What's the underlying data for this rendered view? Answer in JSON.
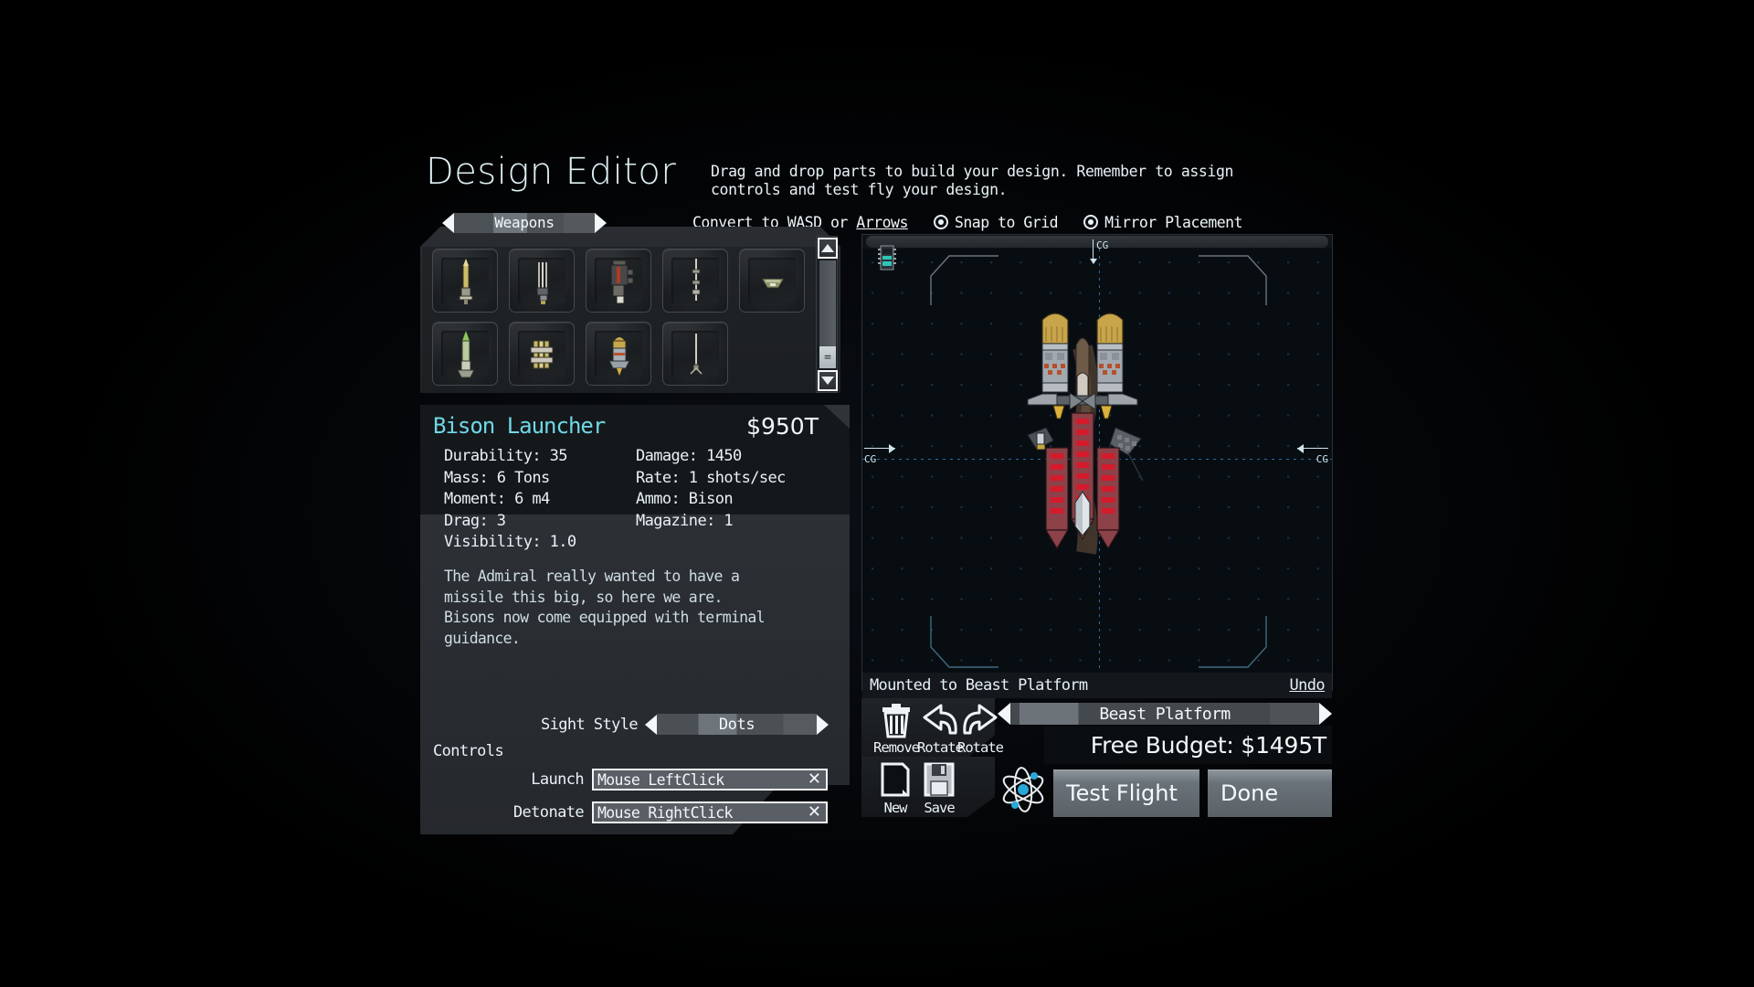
{
  "header": {
    "title": "Design Editor",
    "subtitle": "Drag and drop parts to build your design. Remember to assign controls and test fly your design."
  },
  "toolbar": {
    "convert_prefix": "Convert to ",
    "convert_wasd": "WASD",
    "convert_or": " or ",
    "convert_arrows": "Arrows",
    "snap_to_grid": "Snap to Grid",
    "snap_to_grid_on": true,
    "mirror_placement": "Mirror Placement",
    "mirror_placement_on": true
  },
  "palette": {
    "category": "Weapons",
    "prev_label": "previous category",
    "next_label": "next category",
    "slots_row1": [
      "missile-gold-icon",
      "multi-barrel-icon",
      "turret-red-icon",
      "beam-rod-icon",
      "dish-pod-icon"
    ],
    "slots_row2": [
      "missile-green-icon",
      "bundle-tubes-icon",
      "bison-launcher-icon",
      "thin-spike-icon"
    ],
    "scrollbar": {
      "grip": "="
    }
  },
  "part": {
    "name": "Bison Launcher",
    "price": "$950T",
    "stats_left": [
      "Durability: 35",
      "Mass: 6 Tons",
      "Moment: 6 m4",
      "Drag: 3",
      "Visibility: 1.0"
    ],
    "stats_right": [
      "Damage: 1450",
      "Rate: 1 shots/sec",
      "Ammo: Bison",
      "Magazine: 1"
    ],
    "description": "The Admiral really wanted to have a\nmissile this big, so here we are.\nBisons now come equipped with terminal\nguidance."
  },
  "sight": {
    "label": "Sight Style",
    "value": "Dots"
  },
  "controls": {
    "title": "Controls",
    "bindings": [
      {
        "label": "Launch",
        "value": "Mouse LeftClick",
        "clear": "✕"
      },
      {
        "label": "Detonate",
        "value": "Mouse RightClick",
        "clear": "✕"
      }
    ]
  },
  "canvas": {
    "cg_top": "CG",
    "cg_left": "CG",
    "cg_right": "CG",
    "chip_icon": "circuit-chip-icon"
  },
  "mount": {
    "text": "Mounted to Beast Platform",
    "undo": "Undo"
  },
  "edit_tools": [
    {
      "name": "remove",
      "label": "Remove",
      "icon": "trash-icon"
    },
    {
      "name": "rotate-ccw",
      "label": "Rotate",
      "icon": "rotate-ccw-icon"
    },
    {
      "name": "rotate-cw",
      "label": "Rotate",
      "icon": "rotate-cw-icon"
    }
  ],
  "file_tools": [
    {
      "name": "new",
      "label": "New",
      "icon": "new-document-icon"
    },
    {
      "name": "save",
      "label": "Save",
      "icon": "floppy-disk-icon"
    }
  ],
  "platform": {
    "value": "Beast Platform"
  },
  "budget": {
    "text": "Free Budget: $1495T"
  },
  "actions": {
    "test_flight": "Test Flight",
    "done": "Done"
  },
  "colors": {
    "accent_cyan": "#6fd8e6",
    "text": "#e9f2f7",
    "panel": "#2b2f33",
    "canvas_bg": "#080d12",
    "grid_dot": "#17304a"
  }
}
